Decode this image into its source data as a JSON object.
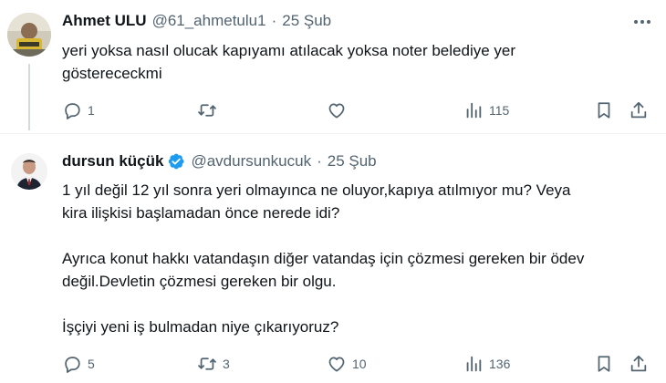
{
  "tweets": [
    {
      "name": "Ahmet ULU",
      "handle": "@61_ahmetulu1",
      "separator": "·",
      "date": "25 Şub",
      "text": "yeri yoksa nasıl olucak kapıyamı atılacak yoksa noter belediye yer\ngösterececkmi",
      "replies": "1",
      "retweets": "",
      "likes": "",
      "views": "115",
      "verified": false
    },
    {
      "name": "dursun küçük",
      "handle": "@avdursunkucuk",
      "separator": "·",
      "date": "25 Şub",
      "text": "1 yıl değil 12 yıl sonra yeri olmayınca ne oluyor,kapıya atılmıyor mu? Veya\nkira ilişkisi başlamadan önce nerede idi?\n\nAyrıca konut hakkı vatandaşın diğer vatandaş için çözmesi gereken bir ödev\ndeğil.Devletin çözmesi gereken bir olgu.\n\nİşçiyi yeni iş bulmadan niye çıkarıyoruz?",
      "replies": "5",
      "retweets": "3",
      "likes": "10",
      "views": "136",
      "verified": true
    }
  ],
  "colors": {
    "text": "#0f1419",
    "secondary": "#536471",
    "verified": "#1d9bf0",
    "thread_line": "#cfd9de"
  },
  "icons": [
    "more-icon",
    "reply-icon",
    "retweet-icon",
    "like-icon",
    "views-icon",
    "bookmark-icon",
    "share-icon",
    "verified-badge-icon"
  ]
}
